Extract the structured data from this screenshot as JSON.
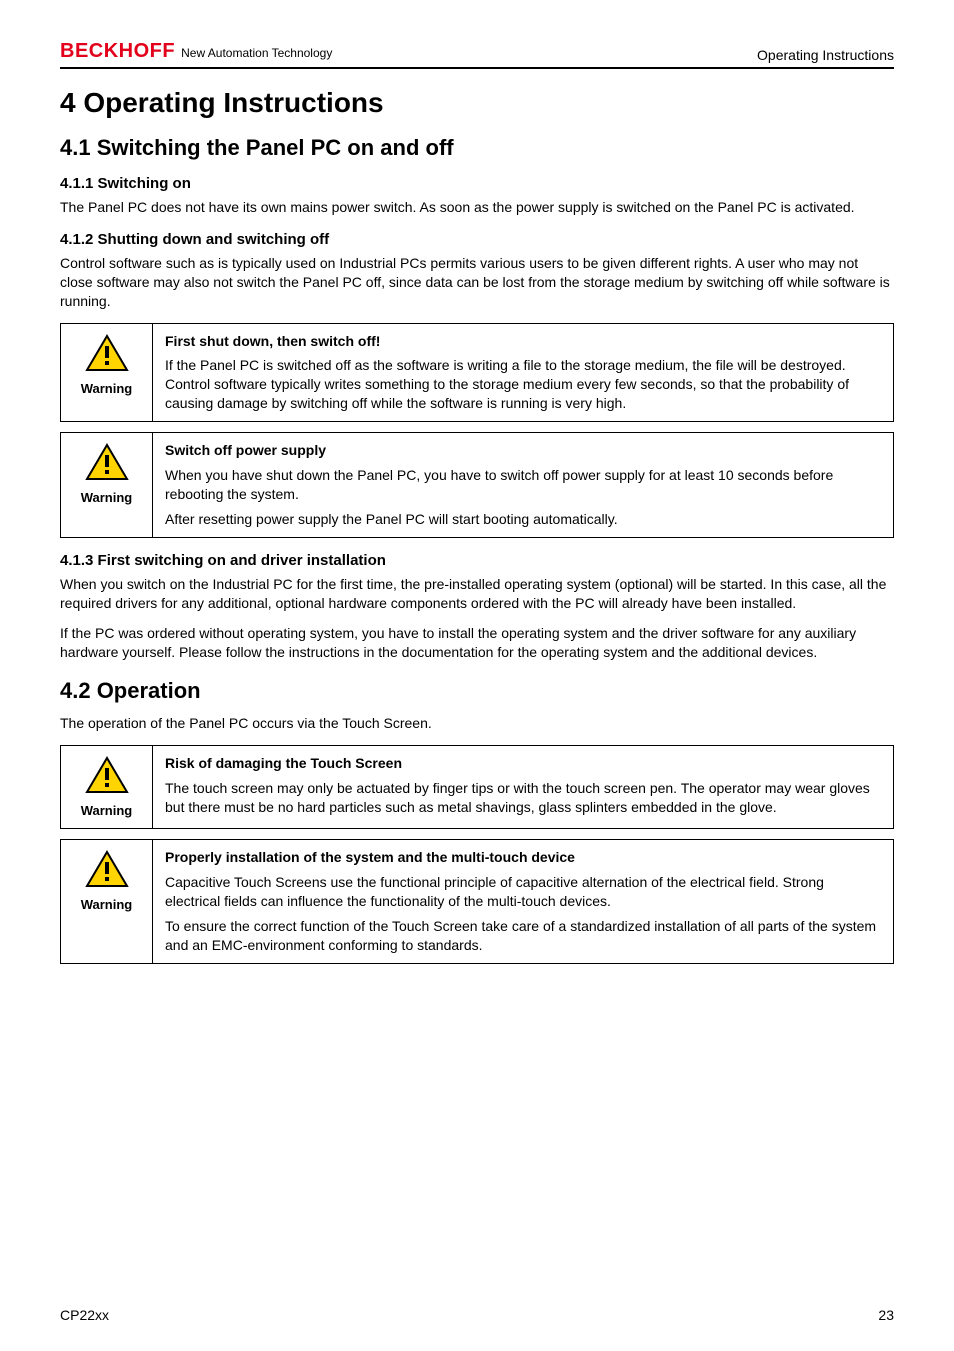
{
  "header": {
    "logo_brand": "BECKHOFF",
    "logo_tagline": "New Automation Technology",
    "right_text": "Operating Instructions"
  },
  "h1": "4  Operating Instructions",
  "s41": {
    "title": "4.1 Switching the Panel PC on and off",
    "s411": {
      "title": "4.1.1  Switching on",
      "p": "The Panel PC does not have its own mains power switch. As soon as the power supply is switched on the Panel PC is activated."
    },
    "s412": {
      "title": "4.1.2  Shutting down and switching off",
      "p": "Control software such as is typically used on Industrial PCs permits various users to be given different rights. A user who may not close software may also not switch the Panel PC off, since data can be lost from the storage medium by switching off while software is running.",
      "warn1": {
        "label": "Warning",
        "title": "First shut down, then switch off!",
        "body": "If the Panel PC is switched off as the software is writing a file to the storage medium, the file will be destroyed. Control software typically writes something to the storage medium every few seconds, so that the probability of causing damage by switching off while the software is running is very high."
      },
      "warn2": {
        "label": "Warning",
        "title": "Switch off power supply",
        "body1": "When you have shut down the Panel PC, you have to switch off power supply for at least 10 seconds before rebooting the system.",
        "body2": "After resetting power supply the Panel PC will start booting automatically."
      }
    },
    "s413": {
      "title": "4.1.3  First switching on and driver installation",
      "p1": "When you switch on the Industrial PC for the first time, the pre-installed operating system (optional) will be started. In this case, all the required drivers for any additional, optional hardware components ordered with the PC will already have been installed.",
      "p2": "If the PC was ordered without operating system, you have to install the operating system and the driver software for any auxiliary hardware yourself. Please follow the instructions in the documentation for the operating system and the additional devices."
    }
  },
  "s42": {
    "title": "4.2 Operation",
    "p": "The operation of the Panel PC occurs via the Touch Screen.",
    "warn1": {
      "label": "Warning",
      "title": "Risk of damaging the Touch Screen",
      "body": "The touch screen may only be actuated by finger tips or with the touch screen pen. The operator may wear gloves but there must be no hard particles such as metal shavings, glass splinters embedded in the glove."
    },
    "warn2": {
      "label": "Warning",
      "title": "Properly installation of the system and the multi-touch device",
      "body1": "Capacitive Touch Screens use the functional principle of capacitive alternation of the electrical field. Strong electrical fields can influence the functionality of the multi-touch devices.",
      "body2": "To ensure the correct function of the Touch Screen take care of a standardized installation of all parts of the system and an EMC-environment conforming to standards."
    }
  },
  "footer": {
    "left": "CP22xx",
    "right": "23"
  }
}
